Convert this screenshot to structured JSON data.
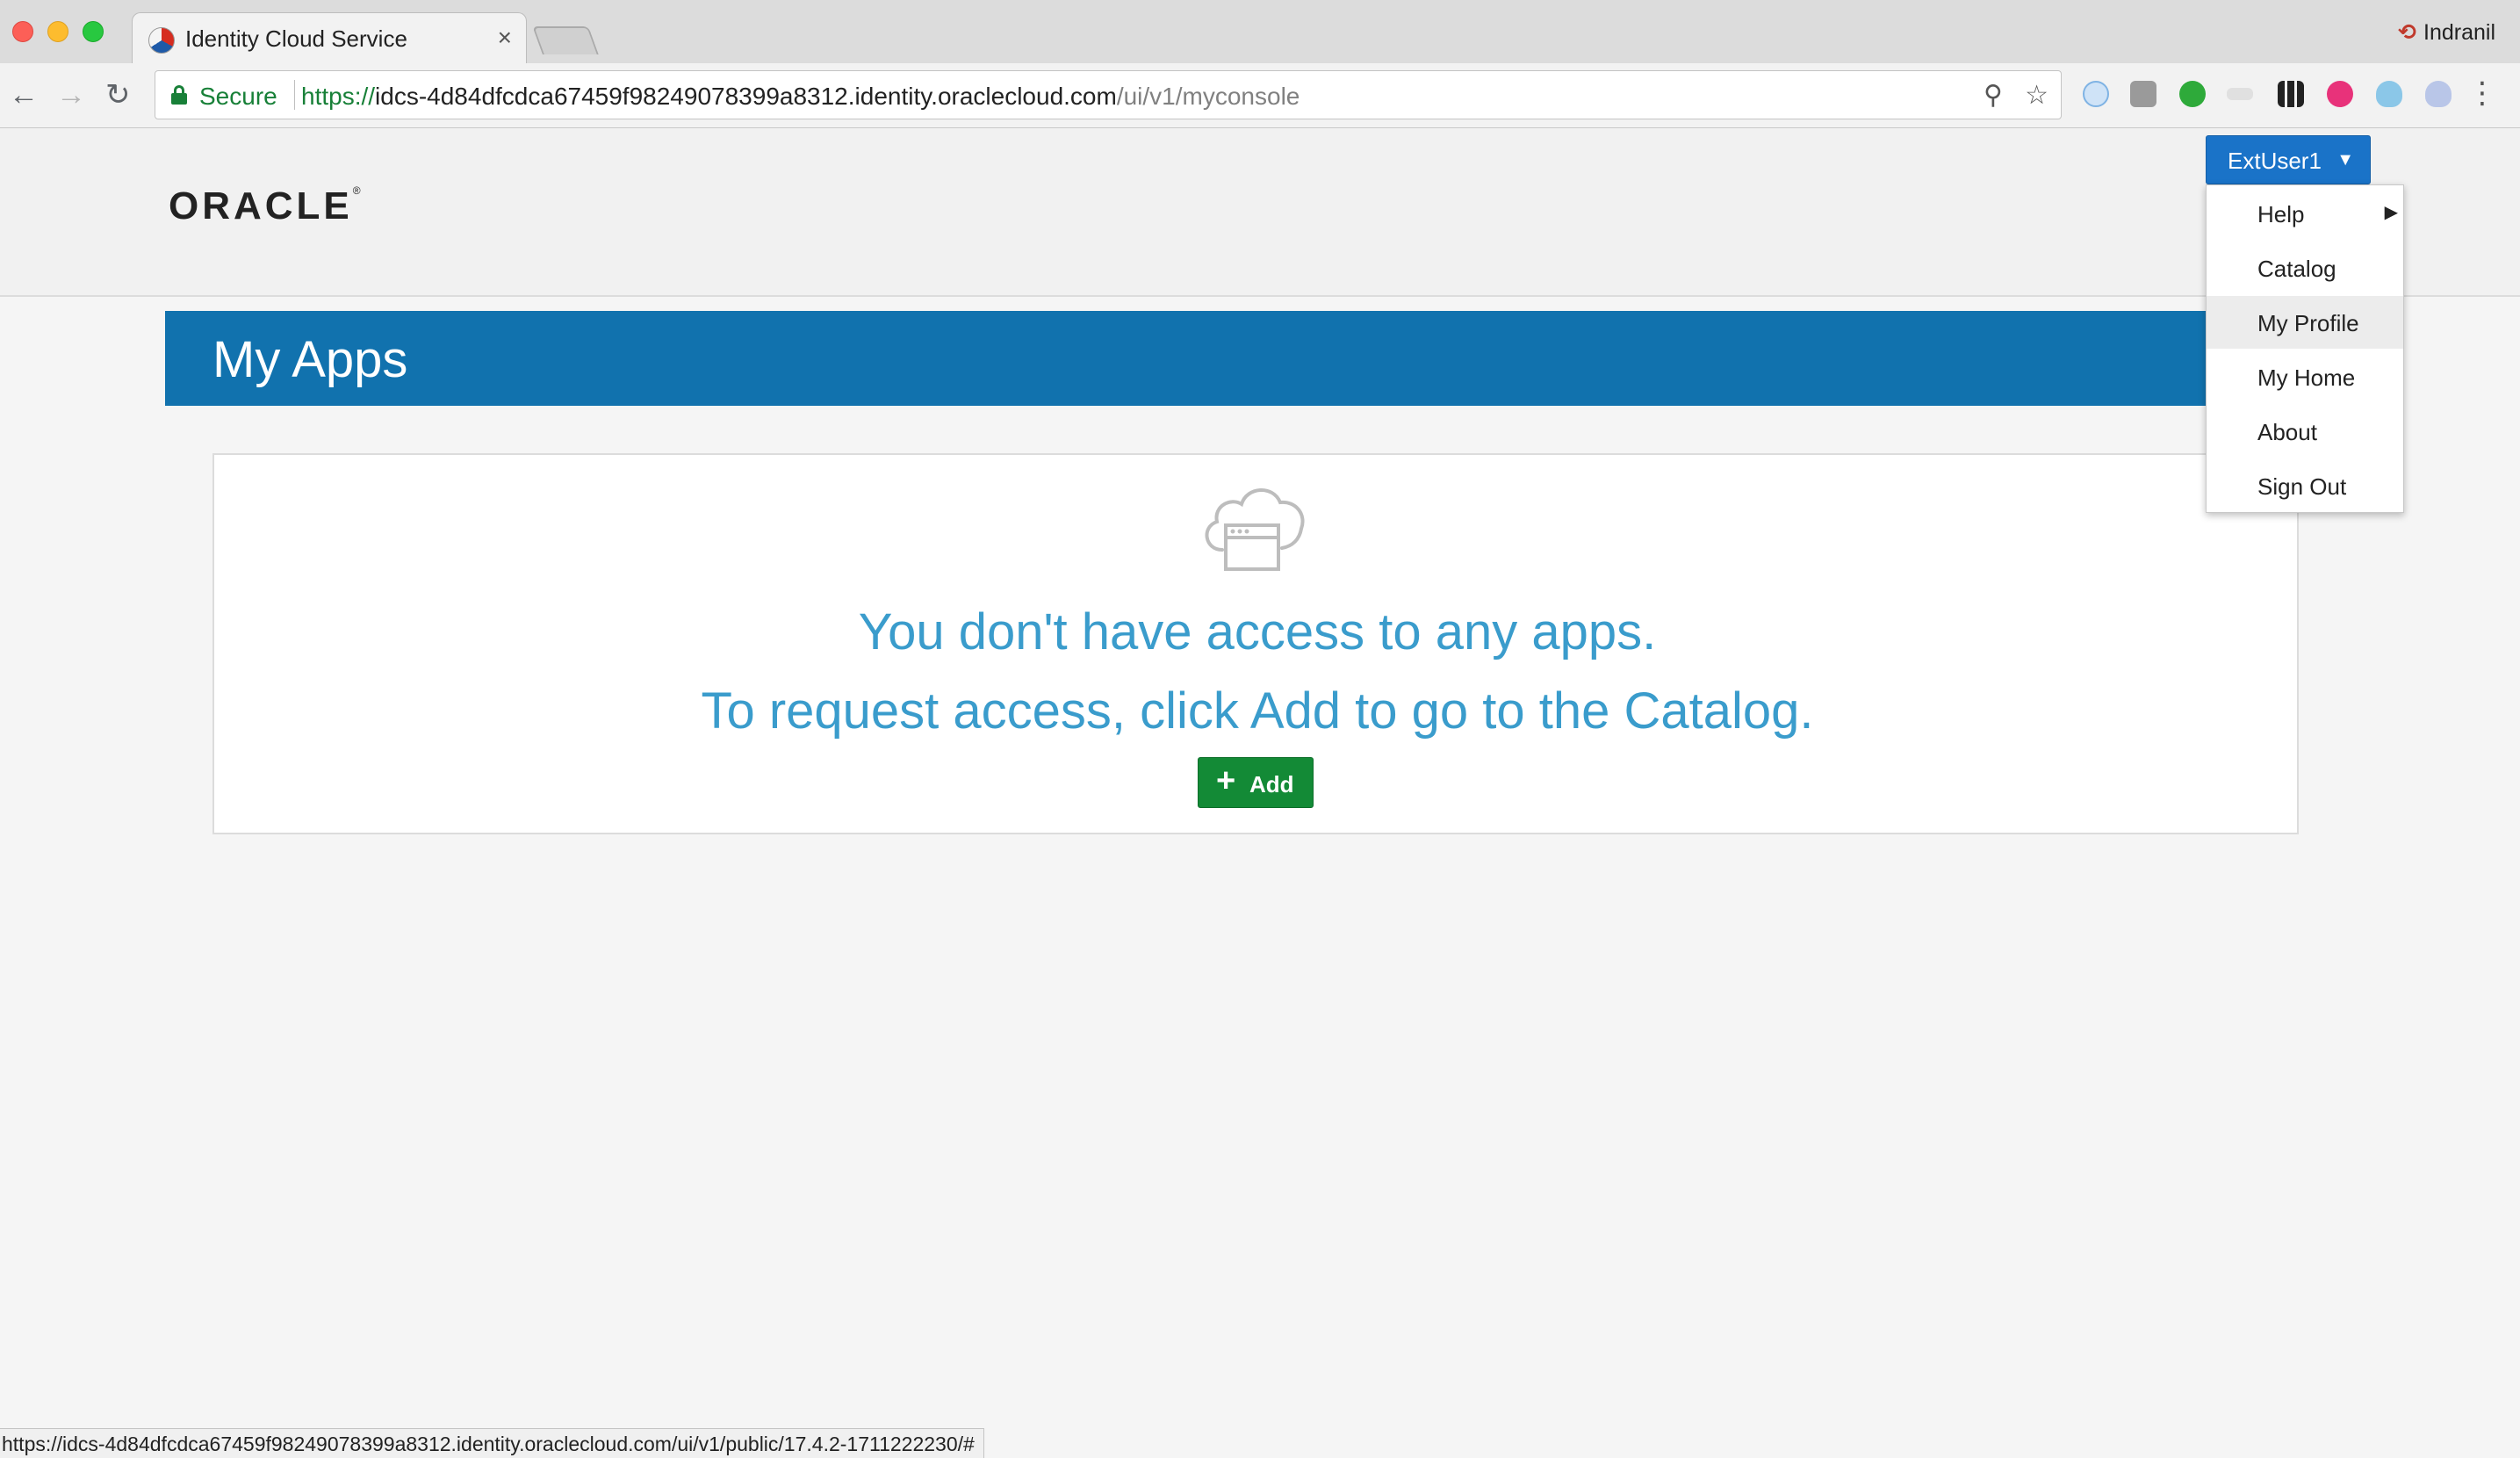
{
  "browser": {
    "tab_title": "Identity Cloud Service",
    "tab_close": "×",
    "profile_name": "Indranil",
    "secure_label": "Secure",
    "url_scheme": "https://",
    "url_host": "idcs-4d84dfcdca67459f98249078399a8312.identity.oraclecloud.com",
    "url_path": "/ui/v1/myconsole",
    "status_url": "https://idcs-4d84dfcdca67459f98249078399a8312.identity.oraclecloud.com/ui/v1/public/17.4.2-1711222230/#"
  },
  "header": {
    "logo_text": "ORACLE",
    "logo_mark": "®"
  },
  "user_menu": {
    "button_label": "ExtUser1",
    "items": [
      {
        "label": "Help",
        "has_submenu": true
      },
      {
        "label": "Catalog"
      },
      {
        "label": "My Profile",
        "highlighted": true
      },
      {
        "label": "My Home"
      },
      {
        "label": "About"
      },
      {
        "label": "Sign Out"
      }
    ]
  },
  "main": {
    "title": "My Apps",
    "empty_line1": "You don't have access to any apps.",
    "empty_line2": "To request access, click Add to go to the Catalog.",
    "add_button": "Add"
  },
  "colors": {
    "banner": "#1172ae",
    "user_button": "#1a73c8",
    "add_button": "#138a36",
    "message_text": "#3a9ccc"
  }
}
